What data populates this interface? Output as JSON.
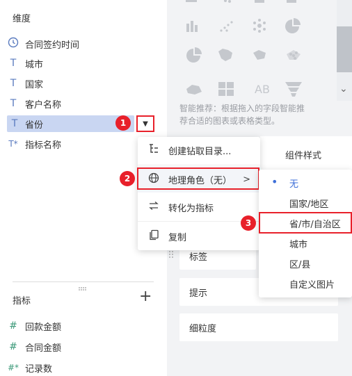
{
  "dimensions": {
    "title": "维度",
    "items": [
      {
        "icon": "clock-icon",
        "glyph": "◷",
        "label": "合同签约时间"
      },
      {
        "icon": "text-icon",
        "glyph": "T",
        "label": "城市"
      },
      {
        "icon": "text-icon",
        "glyph": "T",
        "label": "国家"
      },
      {
        "icon": "text-icon",
        "glyph": "T",
        "label": "客户名称"
      },
      {
        "icon": "text-icon",
        "glyph": "T",
        "label": "省份"
      },
      {
        "icon": "text-calc-icon",
        "glyph": "T*",
        "label": "指标名称"
      }
    ]
  },
  "measures": {
    "title": "指标",
    "add_glyph": "+",
    "items": [
      {
        "icon": "hash-icon",
        "glyph": "#",
        "label": "回款金额"
      },
      {
        "icon": "hash-icon",
        "glyph": "#",
        "label": "合同金额"
      },
      {
        "icon": "hash-calc-icon",
        "glyph": "#*",
        "label": "记录数"
      }
    ]
  },
  "dropdown_glyph": "▼",
  "badges": [
    "1",
    "2",
    "3"
  ],
  "context_menu": {
    "items": [
      {
        "icon": "drill-icon",
        "label": "创建钻取目录..."
      },
      {
        "icon": "globe-icon",
        "label": "地理角色（无）",
        "arrow": ">"
      },
      {
        "icon": "swap-icon",
        "label": "转化为指标"
      },
      {
        "icon": "copy-icon",
        "label": "复制"
      }
    ]
  },
  "geo_submenu": {
    "bullet": "•",
    "items": [
      "无",
      "国家/地区",
      "省/市/自治区",
      "城市",
      "区/县",
      "自定义图片"
    ],
    "selected_index": 0
  },
  "right_panel": {
    "smart_hint": "智能推荐：根据拖入的字段智能推荐合适的图表或表格类型。",
    "smart_hint_line1": "智能推荐：根据拖入的字段智能推",
    "smart_hint_line2": "荐合适的图表或表格类型。",
    "component_style_title": "组件样式",
    "props": [
      "标签",
      "提示",
      "细粒度"
    ],
    "scroll_down_glyph": "⌄"
  },
  "colors": {
    "accent": "#3e6fd8",
    "badge_red": "#e8202a",
    "selected_bg": "#c9d6f2",
    "icon_blue": "#5a7bbf"
  }
}
